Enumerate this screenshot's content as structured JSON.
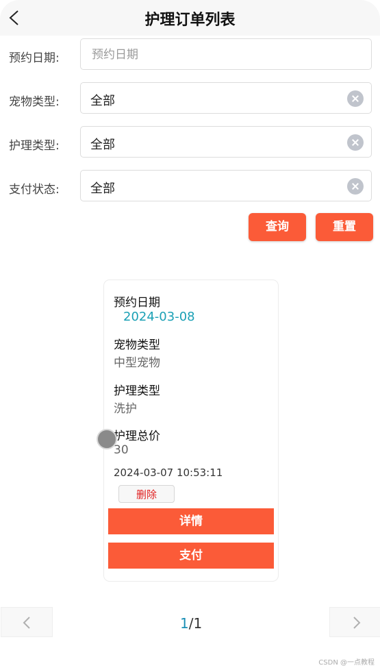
{
  "header": {
    "title": "护理订单列表"
  },
  "filters": [
    {
      "label": "预约日期:",
      "placeholder": "预约日期",
      "value": ""
    },
    {
      "label": "宠物类型:",
      "value": "全部"
    },
    {
      "label": "护理类型:",
      "value": "全部"
    },
    {
      "label": "支付状态:",
      "value": "全部"
    }
  ],
  "actions": {
    "query": "查询",
    "reset": "重置"
  },
  "card": {
    "date_label": "预约日期",
    "date_value": "2024-03-08",
    "pet_label": "宠物类型",
    "pet_value": "中型宠物",
    "care_label": "护理类型",
    "care_value": "洗护",
    "price_label": "护理总价",
    "price_value": "30",
    "timestamp": "2024-03-07 10:53:11",
    "delete": "删除",
    "detail": "详情",
    "pay": "支付"
  },
  "pager": {
    "current": "1",
    "total": "/1"
  },
  "watermark": "CSDN @一点教程",
  "colors": {
    "accent": "#fb5b38",
    "link": "#1aa0b5"
  }
}
